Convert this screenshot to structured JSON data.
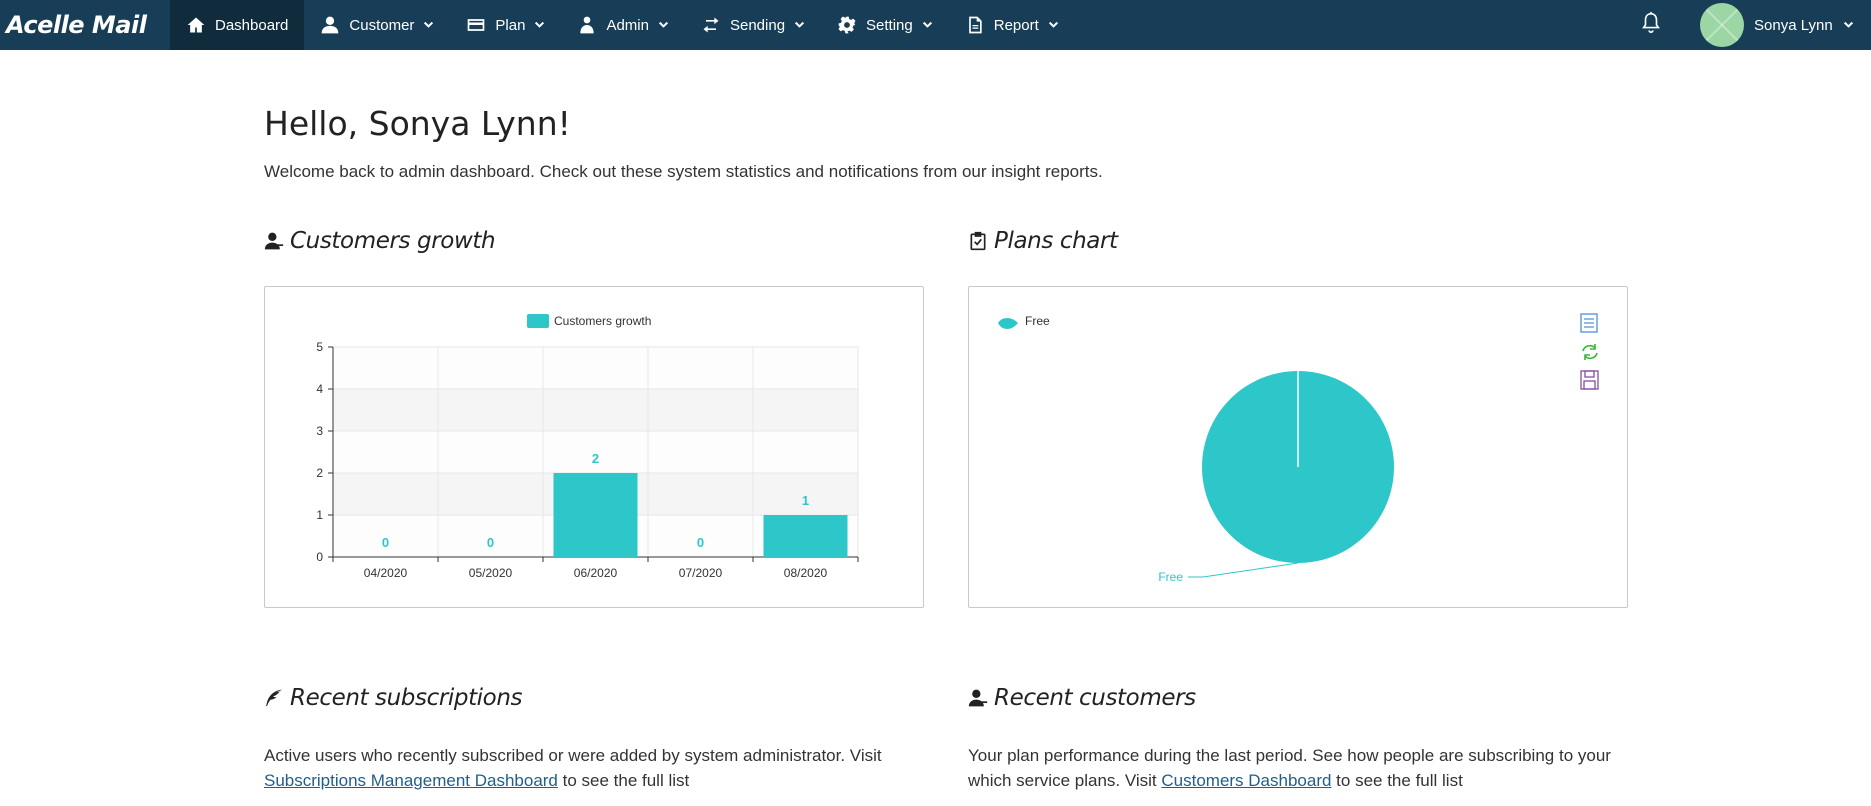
{
  "brand": {
    "name": "Acelle Mail"
  },
  "nav": {
    "items": [
      {
        "label": "Dashboard",
        "icon": "home-icon",
        "active": true
      },
      {
        "label": "Customer",
        "icon": "user-icon"
      },
      {
        "label": "Plan",
        "icon": "credit-card-icon"
      },
      {
        "label": "Admin",
        "icon": "admin-icon"
      },
      {
        "label": "Sending",
        "icon": "exchange-icon"
      },
      {
        "label": "Setting",
        "icon": "gear-icon"
      },
      {
        "label": "Report",
        "icon": "document-icon"
      }
    ],
    "user_name": "Sonya Lynn"
  },
  "page": {
    "greeting": "Hello, Sonya Lynn!",
    "welcome": "Welcome back to admin dashboard. Check out these system statistics and notifications from our insight reports."
  },
  "customers_growth": {
    "title": "Customers growth"
  },
  "plans_chart": {
    "title": "Plans chart"
  },
  "recent_subscriptions": {
    "title": "Recent subscriptions",
    "text_before": "Active users who recently subscribed or were added by system administrator. Visit",
    "link": "Subscriptions Management Dashboard",
    "text_after": " to see the full list"
  },
  "recent_customers": {
    "title": "Recent customers",
    "text_before": "Your plan performance during the last period. See how people are subscribing to your which service plans. Visit ",
    "link": "Customers Dashboard",
    "text_after": " to see the full list"
  },
  "colors": {
    "nav_bg": "#173e56",
    "nav_active": "#102b3c",
    "accent": "#2ec7c9",
    "link": "#1f5f8b"
  },
  "chart_data": [
    {
      "type": "bar",
      "legend": "Customers growth",
      "categories": [
        "04/2020",
        "05/2020",
        "06/2020",
        "07/2020",
        "08/2020"
      ],
      "values": [
        0,
        0,
        2,
        0,
        1
      ],
      "y_ticks": [
        "0",
        "1",
        "2",
        "3",
        "4",
        "5"
      ],
      "ylim": [
        0,
        5
      ],
      "grid": true,
      "legend_position": "top"
    },
    {
      "type": "pie",
      "legend": "Free",
      "slices": [
        {
          "label": "Free",
          "value": 100
        }
      ],
      "legend_position": "top-left"
    }
  ]
}
